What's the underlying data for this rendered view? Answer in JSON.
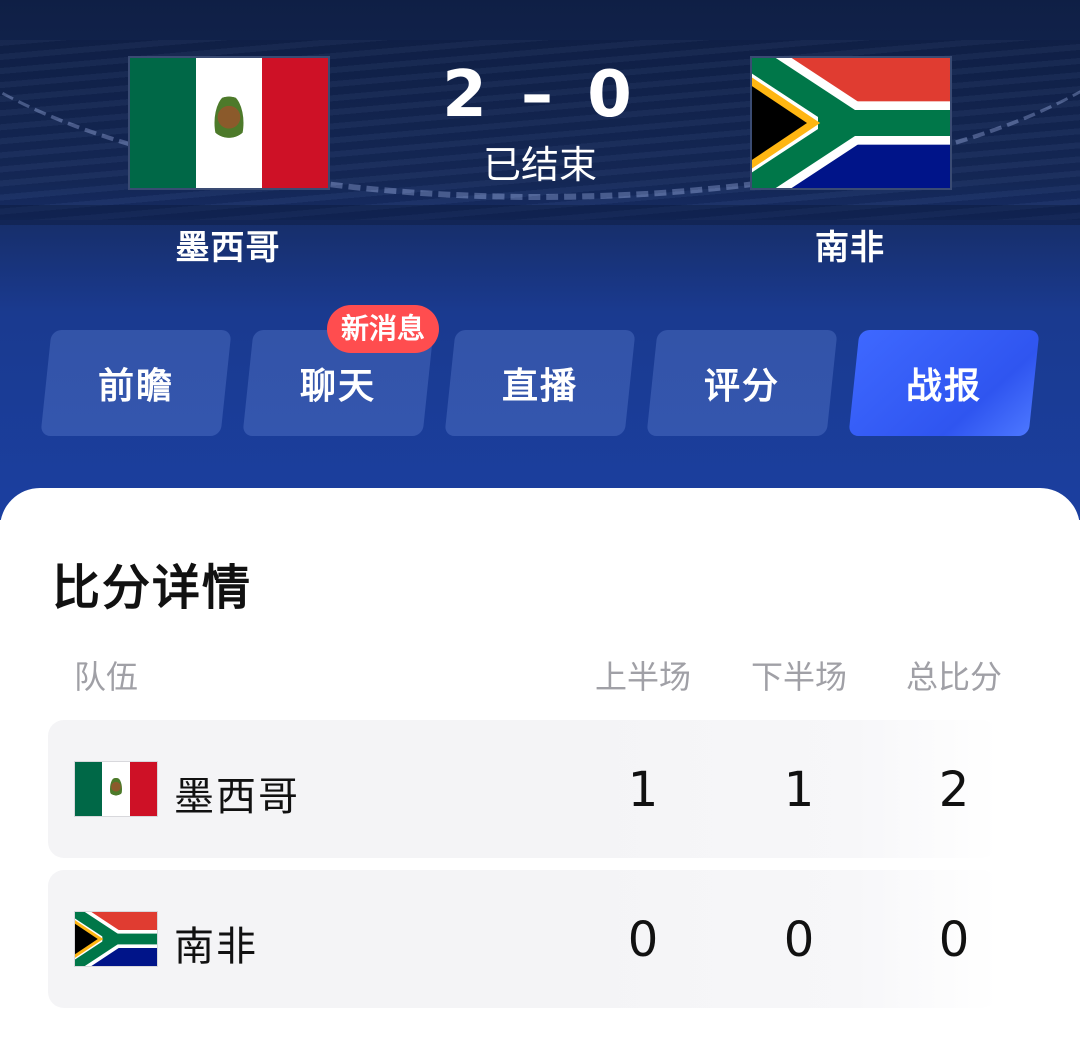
{
  "match": {
    "home_team": "墨西哥",
    "away_team": "南非",
    "score": "2 – 0",
    "status": "已结束"
  },
  "tabs": [
    {
      "label": "前瞻",
      "active": false
    },
    {
      "label": "聊天",
      "active": false
    },
    {
      "label": "直播",
      "active": false
    },
    {
      "label": "评分",
      "active": false
    },
    {
      "label": "战报",
      "active": true
    }
  ],
  "chat_badge": "新消息",
  "score_detail": {
    "title": "比分详情",
    "columns": {
      "team": "队伍",
      "first_half": "上半场",
      "second_half": "下半场",
      "total": "总比分"
    },
    "rows": [
      {
        "team": "墨西哥",
        "first_half": "1",
        "second_half": "1",
        "total": "2",
        "flag": "mexico-flag"
      },
      {
        "team": "南非",
        "first_half": "0",
        "second_half": "0",
        "total": "0",
        "flag": "south-africa-flag"
      }
    ]
  },
  "colors": {
    "header_bg": "#1a3a8f",
    "active_tab": "#3e68ff",
    "badge": "#ff4d4f"
  }
}
